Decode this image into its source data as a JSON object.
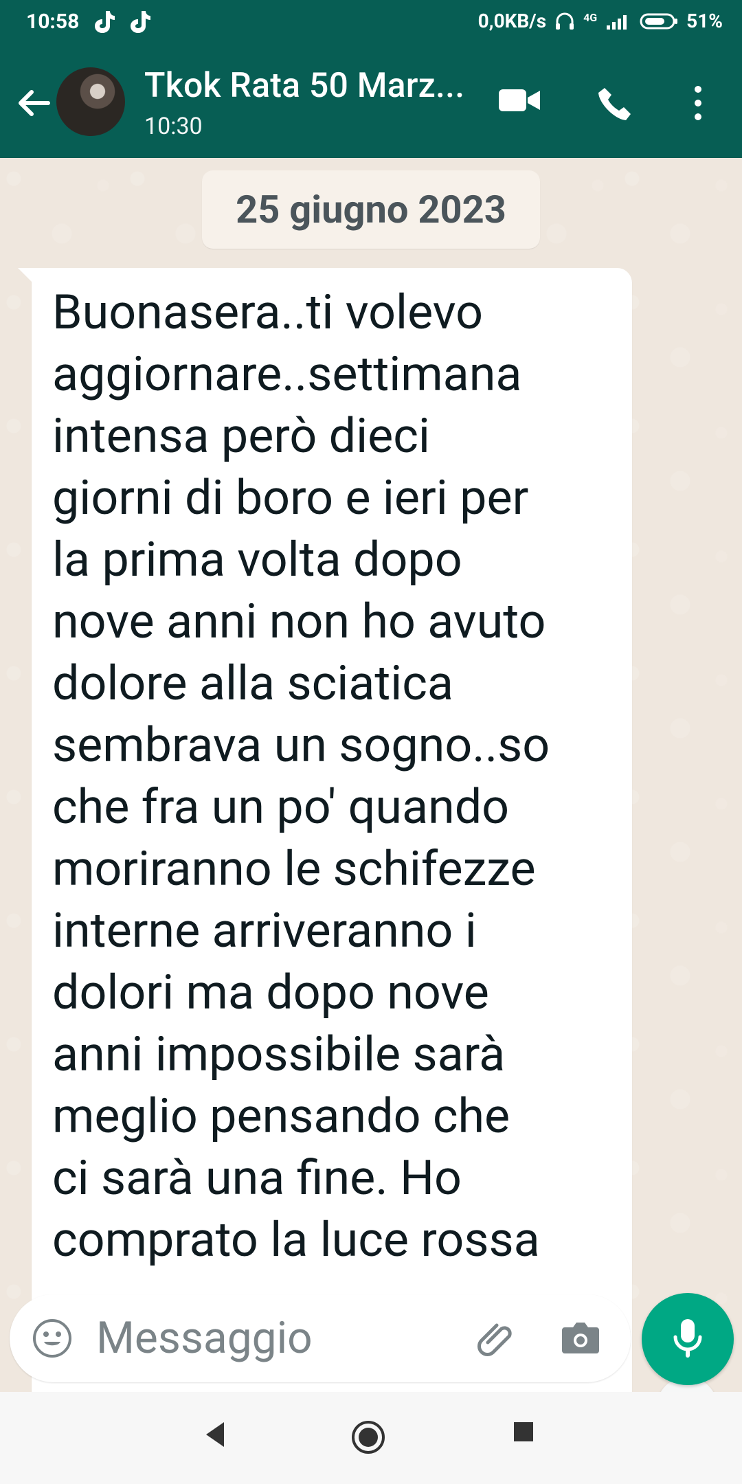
{
  "status_bar": {
    "time": "10:58",
    "network_speed": "0,0KB/s",
    "network_type": "4G",
    "battery": "51%"
  },
  "app_bar": {
    "title": "Tkok Rata 50 Marz...",
    "subtitle": "10:30",
    "icons": {
      "back": "back-arrow-icon",
      "video": "video-call-icon",
      "call": "phone-call-icon",
      "more": "more-vert-icon"
    }
  },
  "chat": {
    "date": "25 giugno 2023",
    "message": "Buonasera..ti volevo\naggiornare..settimana\nintensa però dieci\ngiorni di boro e ieri per\nla prima volta dopo\nnove anni non ho avuto\ndolore alla sciatica\nsembrava un sogno..so\nche fra un po' quando\nmoriranno le schifezze\ninterne arriveranno i\ndolori ma dopo nove\nanni impossibile sarà\nmeglio pensando che\nci sarà una fine. Ho\ncomprato la luce rossa"
  },
  "composer": {
    "placeholder": "Messaggio",
    "icons": {
      "emoji": "emoji-icon",
      "attach": "attach-icon",
      "camera": "camera-icon",
      "mic": "microphone-icon"
    }
  },
  "colors": {
    "header": "#075e54",
    "accent": "#00a884",
    "chat_bg": "#efe7de",
    "bubble": "#ffffff"
  }
}
